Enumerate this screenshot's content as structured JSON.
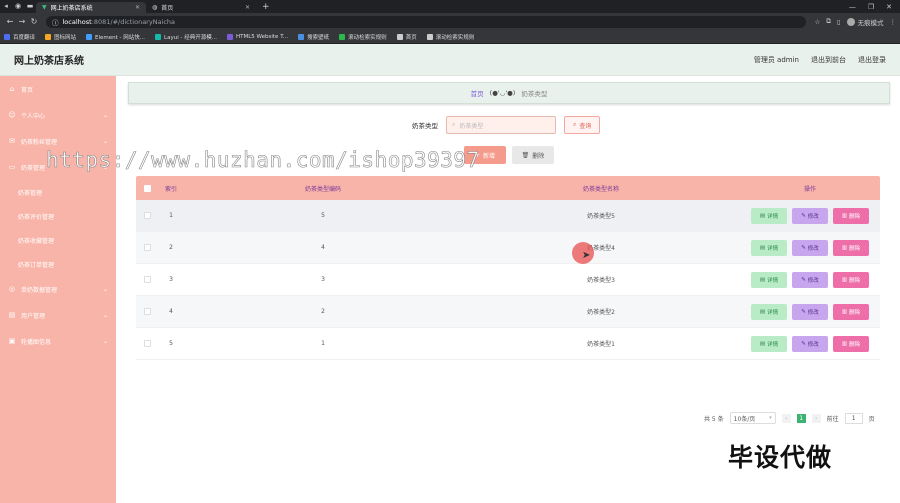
{
  "browser": {
    "tabs": [
      {
        "title": "网上奶茶店系统",
        "active": true
      },
      {
        "title": "首页",
        "active": false
      }
    ],
    "url_host": "localhost",
    "url_path": ":8081/#/dictionaryNaicha",
    "profile_label": "无痕模式",
    "bookmarks": [
      {
        "label": "百度翻译",
        "color": "#4e6ef2"
      },
      {
        "label": "图标网站",
        "color": "#f5a623"
      },
      {
        "label": "Element - 网站快...",
        "color": "#409eff"
      },
      {
        "label": "Layui - 经典开源模...",
        "color": "#16baaa"
      },
      {
        "label": "HTML5 Website T...",
        "color": "#7b5cd6"
      },
      {
        "label": "搜索壁纸",
        "color": "#4a90e2"
      },
      {
        "label": "滚动检索实规则",
        "color": "#2db84c"
      },
      {
        "label": "首页",
        "color": "#cccccc"
      },
      {
        "label": "滚动检索实规则",
        "color": "#cccccc"
      }
    ]
  },
  "header": {
    "title": "网上奶茶店系统",
    "user_label": "管理员 admin",
    "back_label": "退出到前台",
    "logout_label": "退出登录"
  },
  "sidebar": {
    "items": [
      {
        "label": "首页",
        "icon": "home-icon",
        "glyph": "⌂",
        "chevron": false
      },
      {
        "label": "个人中心",
        "icon": "user-icon",
        "glyph": "☺",
        "chevron": true
      },
      {
        "label": "奶茶粉丝管理",
        "icon": "mail-icon",
        "glyph": "✉",
        "chevron": true
      },
      {
        "label": "奶茶管理",
        "icon": "monitor-icon",
        "glyph": "▭",
        "chevron": true
      }
    ],
    "subitems": [
      "奶茶管理",
      "奶茶评价管理",
      "奶茶收藏管理",
      "奶茶订单管理"
    ],
    "items2": [
      {
        "label": "单奶数据管理",
        "icon": "compass-icon",
        "glyph": "◎",
        "chevron": true
      },
      {
        "label": "用户管理",
        "icon": "group-icon",
        "glyph": "▤",
        "chevron": true
      },
      {
        "label": "轮播图信息",
        "icon": "image-icon",
        "glyph": "▣",
        "chevron": true
      }
    ]
  },
  "breadcrumb": {
    "home": "首页",
    "face": "(●'◡'●)",
    "current": "奶茶类型"
  },
  "search": {
    "label": "奶茶类型",
    "placeholder": "奶茶类型",
    "button": "查询"
  },
  "actions": {
    "add": "新增",
    "delete": "删除"
  },
  "table": {
    "headers": {
      "index": "索引",
      "code": "奶茶类型编码",
      "name": "奶茶类型名称",
      "ops": "操作"
    },
    "op_labels": {
      "detail": "详情",
      "edit": "修改",
      "delete": "删除"
    },
    "rows": [
      {
        "index": "1",
        "code": "5",
        "name": "奶茶类型5"
      },
      {
        "index": "2",
        "code": "4",
        "name": "奶茶类型4"
      },
      {
        "index": "3",
        "code": "3",
        "name": "奶茶类型3"
      },
      {
        "index": "4",
        "code": "2",
        "name": "奶茶类型2"
      },
      {
        "index": "5",
        "code": "1",
        "name": "奶茶类型1"
      }
    ]
  },
  "pagination": {
    "total": "共 5 条",
    "page_size": "10条/页",
    "current": "1",
    "goto_label": "前往",
    "goto_value": "1",
    "page_unit": "页"
  },
  "overlay": {
    "watermark": "https://www.huzhan.com/ishop39397",
    "stamp": "毕设代做"
  }
}
